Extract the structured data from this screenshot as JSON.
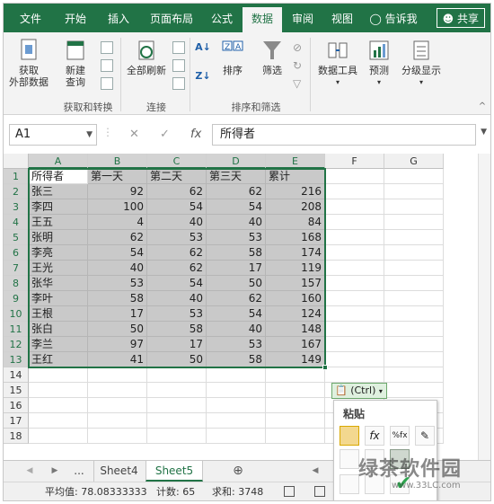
{
  "ribbon_tabs": [
    "文件",
    "开始",
    "插入",
    "页面布局",
    "公式",
    "数据",
    "审阅",
    "视图"
  ],
  "active_tab": "数据",
  "tell_me": "告诉我",
  "share": "共享",
  "ribbon": {
    "get_external": "获取\n外部数据",
    "new_query": "新建\n查询",
    "group1": "获取和转换",
    "refresh_all": "全部刷新",
    "group2": "连接",
    "sort": "排序",
    "filter": "筛选",
    "group3": "排序和筛选",
    "data_tools": "数据工具",
    "forecast": "预测",
    "outline": "分级显示"
  },
  "namebox": "A1",
  "formula": "所得者",
  "columns": [
    "A",
    "B",
    "C",
    "D",
    "E",
    "F",
    "G"
  ],
  "rows": [
    [
      "所得者",
      "第一天",
      "第二天",
      "第三天",
      "累计"
    ],
    [
      "张三",
      "92",
      "62",
      "62",
      "216"
    ],
    [
      "李四",
      "100",
      "54",
      "54",
      "208"
    ],
    [
      "王五",
      "4",
      "40",
      "40",
      "84"
    ],
    [
      "张明",
      "62",
      "53",
      "53",
      "168"
    ],
    [
      "李亮",
      "54",
      "62",
      "58",
      "174"
    ],
    [
      "王光",
      "40",
      "62",
      "17",
      "119"
    ],
    [
      "张华",
      "53",
      "54",
      "50",
      "157"
    ],
    [
      "李叶",
      "58",
      "40",
      "62",
      "160"
    ],
    [
      "王根",
      "17",
      "53",
      "54",
      "124"
    ],
    [
      "张白",
      "50",
      "58",
      "40",
      "148"
    ],
    [
      "李兰",
      "97",
      "17",
      "53",
      "167"
    ],
    [
      "王红",
      "41",
      "50",
      "58",
      "149"
    ]
  ],
  "row_numbers": [
    "1",
    "2",
    "3",
    "4",
    "5",
    "6",
    "7",
    "8",
    "9",
    "10",
    "11",
    "12",
    "13",
    "14",
    "15",
    "16",
    "17",
    "18"
  ],
  "sheet_tabs": {
    "ellipsis": "...",
    "sheet4": "Sheet4",
    "sheet5": "Sheet5"
  },
  "status": {
    "average": "平均值: 78.08333333",
    "count": "计数: 65",
    "sum": "求和: 3748"
  },
  "paste": {
    "ctrl": "(Ctrl)",
    "title": "粘贴"
  },
  "watermark": {
    "main": "绿茶软件园",
    "url": "www.33LC.com"
  }
}
